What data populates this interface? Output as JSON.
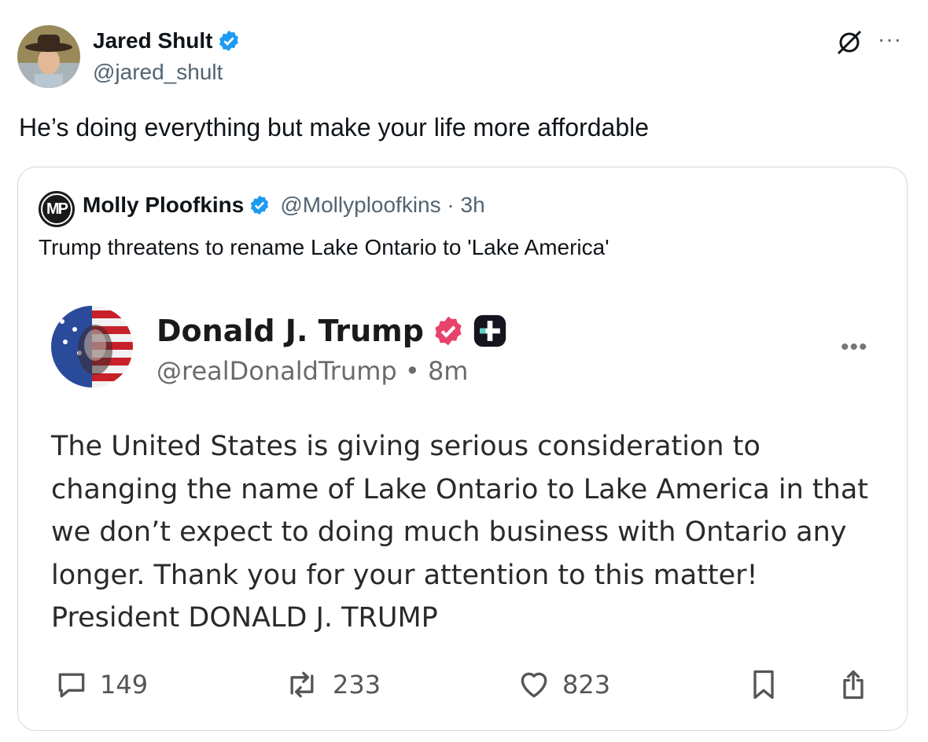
{
  "author": {
    "name": "Jared Shult",
    "handle": "@jared_shult"
  },
  "tweet": {
    "text": "He’s doing everything but make your life more affordable"
  },
  "quote": {
    "avatar_initials": "MP",
    "name": "Molly Ploofkins",
    "handle_time": "@Mollyploofkins · 3h",
    "text": "Trump threatens to rename Lake Ontario to 'Lake America'"
  },
  "embedded_post": {
    "name": "Donald J. Trump",
    "handle_time": "@realDonaldTrump • 8m",
    "body": "The United States is giving serious consideration to changing the name of Lake Ontario to Lake America in that we don’t expect to doing much business with Ontario any longer. Thank you for your attention to this matter! President DONALD J. TRUMP",
    "replies": "149",
    "retruths": "233",
    "likes": "823"
  },
  "colors": {
    "verified_blue": "#1d9bf0",
    "truth_badge": "#e8436a",
    "secondary_text": "#536471",
    "border": "#cfd9de"
  }
}
